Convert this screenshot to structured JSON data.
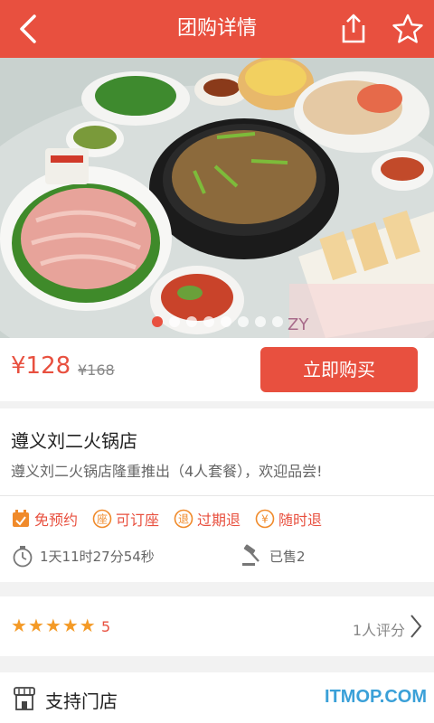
{
  "header": {
    "title": "团购详情",
    "icons": [
      "back-arrow-icon",
      "share-icon",
      "star-icon"
    ]
  },
  "hero": {
    "image": "hotpot-meal-photo",
    "watermark": "ZY",
    "slide_count": 8,
    "active_slide": 0
  },
  "purchase": {
    "price": "¥128",
    "original_price": "¥168",
    "buy_label": "立即购买"
  },
  "deal": {
    "shop_name": "遵义刘二火锅店",
    "description": "遵义刘二火锅店隆重推出（4人套餐），欢迎品尝!",
    "tags": [
      {
        "label": "免预约",
        "icon": "calendar-icon"
      },
      {
        "label": "可订座",
        "icon": "seat-icon",
        "badge": "座"
      },
      {
        "label": "过期退",
        "icon": "refund-icon",
        "badge": "退"
      },
      {
        "label": "随时退",
        "icon": "yen-icon",
        "badge": "¥"
      }
    ],
    "countdown": "1天11时27分54秒",
    "sold": "已售2"
  },
  "rating": {
    "stars": 5,
    "score": "5",
    "count_label": "1人评分"
  },
  "stores": {
    "label": "支持门店"
  },
  "watermark": "ITMOP.COM",
  "colors": {
    "accent": "#e8503f",
    "star": "#f49a26",
    "watermark": "#3aa0d8"
  }
}
